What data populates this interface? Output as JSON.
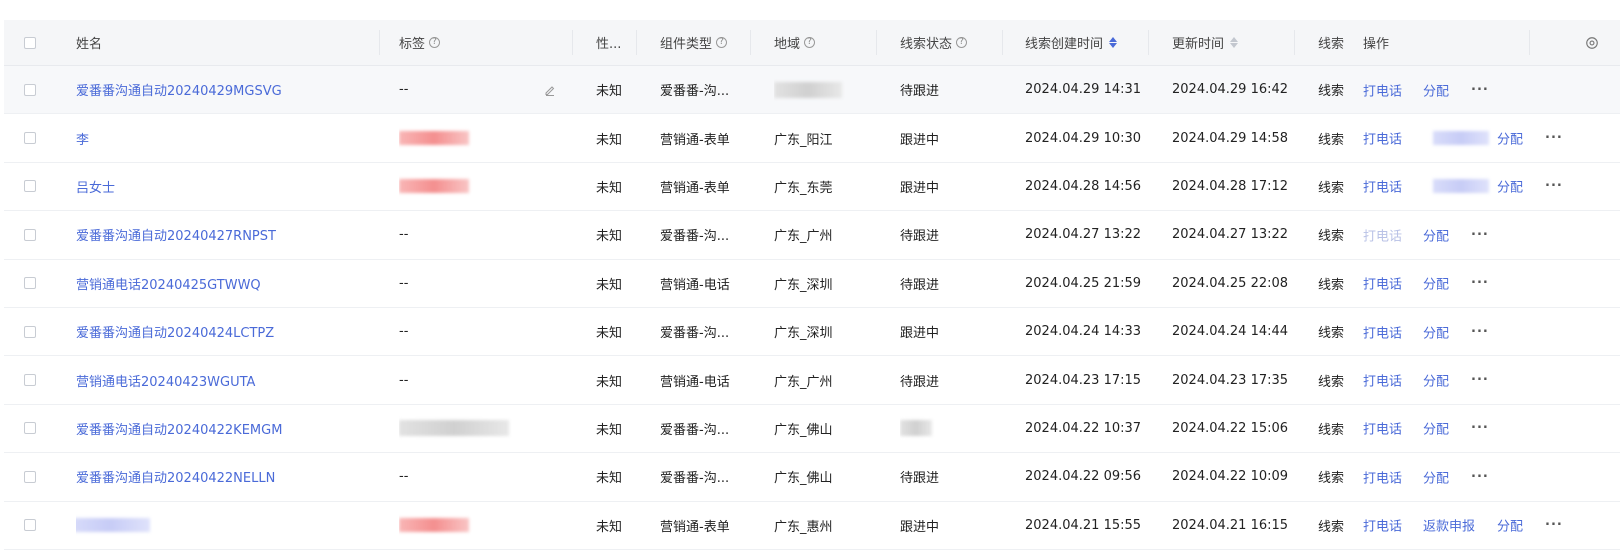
{
  "header": {
    "name": "姓名",
    "tag": "标签",
    "gender": "性...",
    "component_type": "组件类型",
    "region": "地域",
    "status": "线索状态",
    "created": "线索创建时间",
    "updated": "更新时间",
    "source": "线索",
    "ops": "操作"
  },
  "ops": {
    "call": "打电话",
    "assign": "分配",
    "refund": "返款申报",
    "more": "···"
  },
  "rows": [
    {
      "name": "爱番番沟通自动20240429MGSVG",
      "tag": "--",
      "gender": "未知",
      "comp": "爱番番-沟...",
      "region": "",
      "status": "待跟进",
      "created": "2024.04.29 14:31",
      "updated": "2024.04.29 16:42",
      "src": "线索"
    },
    {
      "name": "李",
      "tag": "",
      "gender": "未知",
      "comp": "营销通-表单",
      "region": "广东_阳江",
      "status": "跟进中",
      "created": "2024.04.29 10:30",
      "updated": "2024.04.29 14:58",
      "src": "线索"
    },
    {
      "name": "吕女士",
      "tag": "",
      "gender": "未知",
      "comp": "营销通-表单",
      "region": "广东_东莞",
      "status": "跟进中",
      "created": "2024.04.28 14:56",
      "updated": "2024.04.28 17:12",
      "src": "线索"
    },
    {
      "name": "爱番番沟通自动20240427RNPST",
      "tag": "--",
      "gender": "未知",
      "comp": "爱番番-沟...",
      "region": "广东_广州",
      "status": "待跟进",
      "created": "2024.04.27 13:22",
      "updated": "2024.04.27 13:22",
      "src": "线索"
    },
    {
      "name": "营销通电话20240425GTWWQ",
      "tag": "--",
      "gender": "未知",
      "comp": "营销通-电话",
      "region": "广东_深圳",
      "status": "待跟进",
      "created": "2024.04.25 21:59",
      "updated": "2024.04.25 22:08",
      "src": "线索"
    },
    {
      "name": "爱番番沟通自动20240424LCTPZ",
      "tag": "--",
      "gender": "未知",
      "comp": "爱番番-沟...",
      "region": "广东_深圳",
      "status": "跟进中",
      "created": "2024.04.24 14:33",
      "updated": "2024.04.24 14:44",
      "src": "线索"
    },
    {
      "name": "营销通电话20240423WGUTA",
      "tag": "--",
      "gender": "未知",
      "comp": "营销通-电话",
      "region": "广东_广州",
      "status": "待跟进",
      "created": "2024.04.23 17:15",
      "updated": "2024.04.23 17:35",
      "src": "线索"
    },
    {
      "name": "爱番番沟通自动20240422KEMGM",
      "tag": "",
      "gender": "未知",
      "comp": "爱番番-沟...",
      "region": "广东_佛山",
      "status": "",
      "created": "2024.04.22 10:37",
      "updated": "2024.04.22 15:06",
      "src": "线索"
    },
    {
      "name": "爱番番沟通自动20240422NELLN",
      "tag": "--",
      "gender": "未知",
      "comp": "爱番番-沟...",
      "region": "广东_佛山",
      "status": "待跟进",
      "created": "2024.04.22 09:56",
      "updated": "2024.04.22 10:09",
      "src": "线索"
    },
    {
      "name": "",
      "tag": "",
      "gender": "未知",
      "comp": "营销通-表单",
      "region": "广东_惠州",
      "status": "跟进中",
      "created": "2024.04.21 15:55",
      "updated": "2024.04.21 16:15",
      "src": "线索"
    }
  ]
}
